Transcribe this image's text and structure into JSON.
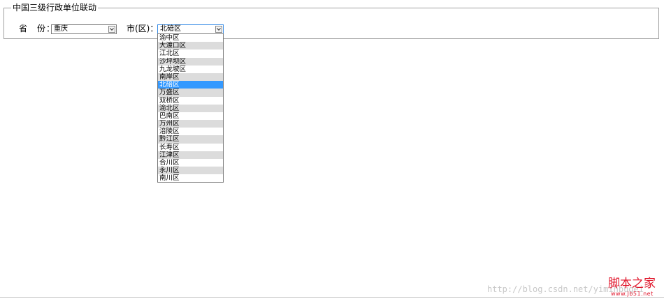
{
  "form": {
    "legend": "中国三级行政单位联动",
    "province_label": "省　份：",
    "city_label": "市(区)："
  },
  "province_select": {
    "value": "重庆"
  },
  "city_select": {
    "value": "北碚区",
    "options": [
      "渝中区",
      "大渡口区",
      "江北区",
      "沙坪坝区",
      "九龙坡区",
      "南岸区",
      "北碚区",
      "万盛区",
      "双桥区",
      "渝北区",
      "巴南区",
      "万州区",
      "涪陵区",
      "黔江区",
      "长寿区",
      "江津区",
      "合川区",
      "永川区",
      "南川区"
    ],
    "selected_index": 6
  },
  "watermark": {
    "url": "http://blog.csdn.net/yiminbugei",
    "logo_text": "脚本之家",
    "logo_domain": "www.Jb51.net"
  },
  "colors": {
    "selected_option": "#3399ff",
    "alt_option": "#dcdcdc",
    "logo": "#e0162b"
  },
  "icons": {
    "dropdown_arrow": "chevron-down-icon"
  }
}
